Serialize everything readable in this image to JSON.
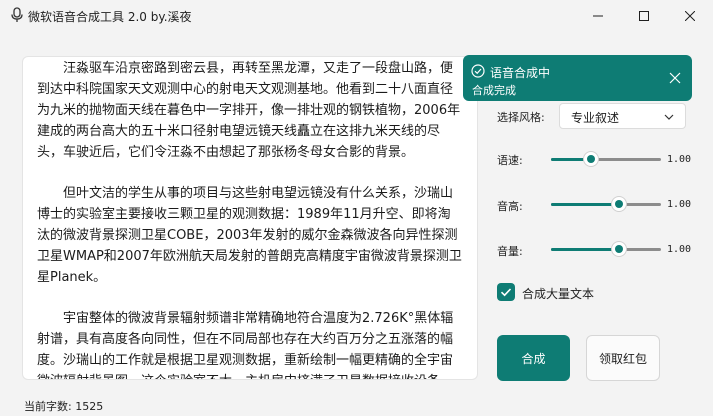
{
  "window": {
    "title": "微软语音合成工具 2.0 by.溪夜",
    "icons": {
      "app": "microphone-icon",
      "minimize": "minimize-icon",
      "maximize": "maximize-icon",
      "close": "close-icon"
    }
  },
  "editor": {
    "paragraphs": [
      "汪淼驱车沿京密路到密云县，再转至黑龙潭，又走了一段盘山路，便到达中科院国家天文观测中心的射电天文观测基地。他看到二十八面直径为九米的抛物面天线在暮色中一字排开，像一排壮观的钢铁植物，2006年建成的两台高大的五十米口径射电望远镜天线矗立在这排九米天线的尽头，车驶近后，它们令汪淼不由想起了那张杨冬母女合影的背景。",
      "但叶文洁的学生从事的项目与这些射电望远镜没有什么关系，沙瑞山博士的实验室主要接收三颗卫星的观测数据：1989年11月升空、即将淘汰的微波背景探测卫星COBE，2003年发射的威尔金森微波各向异性探测卫星WMAP和2007年欧洲航天局发射的普朗克高精度宇宙微波背景探测卫星Planek。",
      "宇宙整体的微波背景辐射频谱非常精确地符合温度为2.726K°黑体辐射谱，具有高度各向同性，但在不同局部也存在大约百万分之五涨落的幅度。沙瑞山的工作就是根据卫星观测数据，重新绘制一幅更精确的全宇宙微波辐射背景图。这个实验室不大，主机房中挤满了卫星数据接收设备，有三台终端分别显示"
    ]
  },
  "status": {
    "char_count": "当前字数: 1525"
  },
  "toast": {
    "title": "语音合成中",
    "message": "合成完成",
    "icon": "check-circle-icon",
    "close_icon": "close-icon"
  },
  "settings": {
    "style_label": "选择风格:",
    "style_value": "专业叙述",
    "sliders": [
      {
        "label": "语速:",
        "value": "1.00",
        "position": 0.36
      },
      {
        "label": "音高:",
        "value": "1.00",
        "position": 0.62
      },
      {
        "label": "音量:",
        "value": "1.00",
        "position": 0.62
      }
    ],
    "bulk_text_label": "合成大量文本",
    "bulk_text_checked": true
  },
  "actions": {
    "synthesize": "合成",
    "red_packet": "领取红包"
  },
  "colors": {
    "accent": "#0e7c74",
    "background": "#f3f3f3",
    "panel": "#ffffff"
  }
}
